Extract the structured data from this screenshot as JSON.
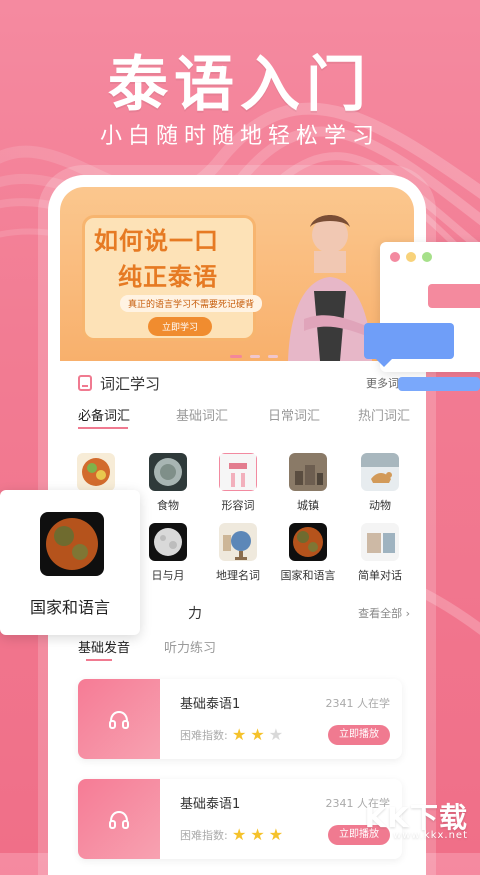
{
  "hero": {
    "title": "泰语入门",
    "subtitle": "小白随时随地轻松学习"
  },
  "banner": {
    "headline_1": "如何说一口",
    "headline_2": "纯正泰语",
    "tagline": "真正的语言学习不需要死记硬背",
    "cta": "立即学习"
  },
  "vocab": {
    "section_title": "词汇学习",
    "more": "更多词汇",
    "tabs": [
      "必备词汇",
      "基础词汇",
      "日常词汇",
      "热门词汇"
    ],
    "categories": [
      {
        "label": "",
        "icon": "food-bowl-icon"
      },
      {
        "label": "食物",
        "icon": "plate-icon"
      },
      {
        "label": "形容词",
        "icon": "card-icon"
      },
      {
        "label": "城镇",
        "icon": "town-icon"
      },
      {
        "label": "动物",
        "icon": "dog-icon"
      },
      {
        "label": "",
        "icon": "blank-icon"
      },
      {
        "label": "日与月",
        "icon": "moon-icon"
      },
      {
        "label": "地理名词",
        "icon": "globe-icon"
      },
      {
        "label": "国家和语言",
        "icon": "earth-icon"
      },
      {
        "label": "简单对话",
        "icon": "chat-icon"
      }
    ]
  },
  "popup": {
    "label": "国家和语言"
  },
  "listening": {
    "title": "力",
    "view_all": "查看全部 ›",
    "tabs": [
      "基础发音",
      "听力练习"
    ],
    "courses": [
      {
        "title": "基础泰语1",
        "learners": "2341 人在学",
        "difficulty_label": "困难指数:",
        "stars": 2,
        "max_stars": 3,
        "play": "立即播放"
      },
      {
        "title": "基础泰语1",
        "learners": "2341 人在学",
        "difficulty_label": "困难指数:",
        "stars": 3,
        "max_stars": 3,
        "play": "立即播放"
      }
    ]
  },
  "watermark": {
    "text": "KK下载",
    "url": "www.kkx.net"
  },
  "colors": {
    "accent": "#f07a90",
    "banner": "#f8b06c",
    "blue": "#6f9ef8"
  }
}
